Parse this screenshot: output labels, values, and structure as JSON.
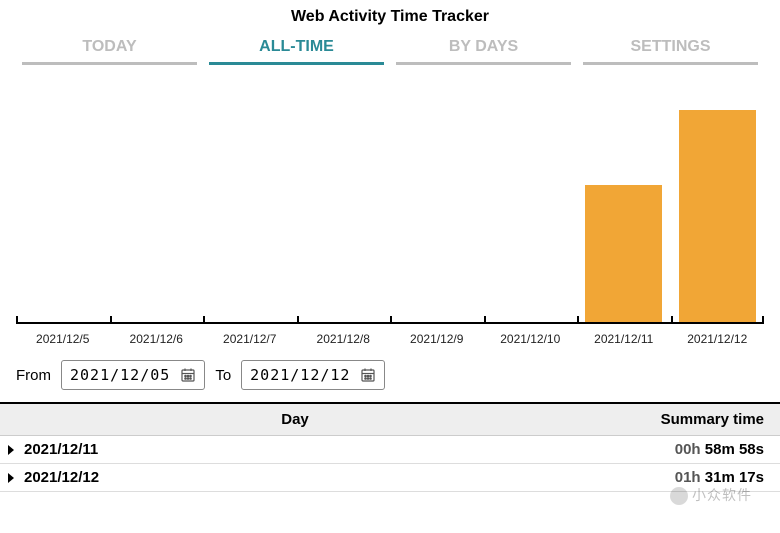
{
  "header": {
    "title": "Web Activity Time Tracker"
  },
  "tabs": {
    "today": "TODAY",
    "all_time": "ALL-TIME",
    "by_days": "BY DAYS",
    "settings": "SETTINGS",
    "active": "all_time"
  },
  "chart_data": {
    "type": "bar",
    "categories": [
      "2021/12/5",
      "2021/12/6",
      "2021/12/7",
      "2021/12/8",
      "2021/12/9",
      "2021/12/10",
      "2021/12/11",
      "2021/12/12"
    ],
    "values": [
      0,
      0,
      0,
      0,
      0,
      0,
      59,
      91
    ],
    "unit": "minutes",
    "title": "",
    "xlabel": "",
    "ylabel": "",
    "ylim": [
      0,
      100
    ],
    "bar_color": "#f1a636"
  },
  "date_range": {
    "from_label": "From",
    "to_label": "To",
    "from_value": "2021/12/05",
    "to_value": "2021/12/12"
  },
  "table": {
    "columns": {
      "day": "Day",
      "summary": "Summary time"
    },
    "rows": [
      {
        "date": "2021/12/11",
        "hours": "00h",
        "rest": "58m 58s"
      },
      {
        "date": "2021/12/12",
        "hours": "01h",
        "rest": "31m 17s"
      }
    ]
  },
  "watermark": "小众软件"
}
